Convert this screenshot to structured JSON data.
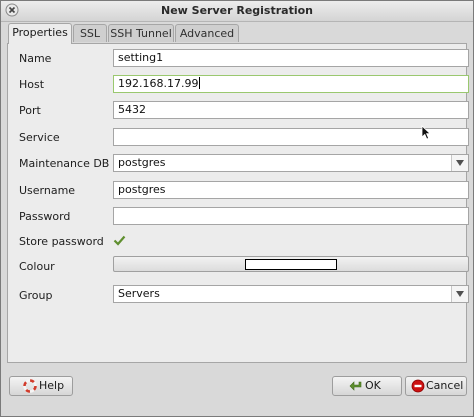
{
  "window": {
    "title": "New Server Registration"
  },
  "tabs": [
    {
      "label": "Properties",
      "active": true
    },
    {
      "label": "SSL"
    },
    {
      "label": "SSH Tunnel"
    },
    {
      "label": "Advanced"
    }
  ],
  "form": {
    "name_label": "Name",
    "name_value": "setting1",
    "host_label": "Host",
    "host_value": "192.168.17.99",
    "port_label": "Port",
    "port_value": "5432",
    "service_label": "Service",
    "service_value": "",
    "maintenance_db_label": "Maintenance DB",
    "maintenance_db_value": "postgres",
    "username_label": "Username",
    "username_value": "postgres",
    "password_label": "Password",
    "password_value": "",
    "store_password_label": "Store password",
    "store_password_checked": true,
    "colour_label": "Colour",
    "colour_value": "#ffffff",
    "group_label": "Group",
    "group_value": "Servers"
  },
  "buttons": {
    "help_label": "Help",
    "ok_label": "OK",
    "cancel_label": "Cancel"
  },
  "icons": {
    "close": "close-icon",
    "help": "help-lifebuoy-icon",
    "ok": "ok-arrow-icon",
    "cancel": "cancel-stop-icon",
    "check": "check-icon",
    "dropdown": "chevron-down-icon"
  },
  "colors": {
    "accent_green": "#5f8f2f",
    "focus_border": "#9ac86f",
    "cancel_red": "#cc1111"
  }
}
